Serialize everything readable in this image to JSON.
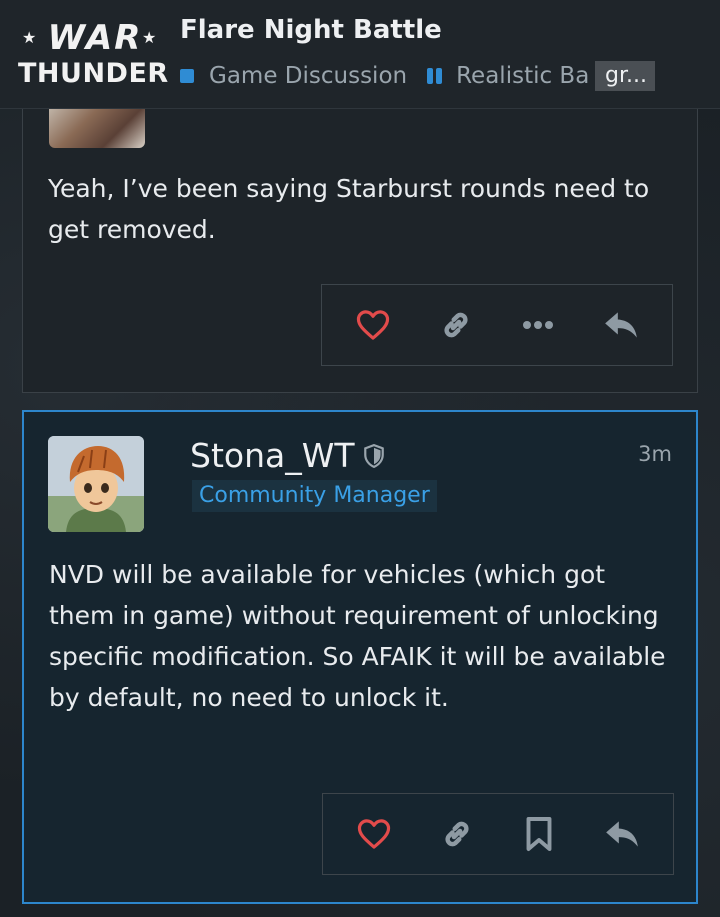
{
  "header": {
    "logo_top": "WAR",
    "logo_bottom": "THUNDER",
    "topic_title": "Flare Night Battle",
    "category": "Game Discussion",
    "subcategory": "Realistic Ba",
    "overflow_label": "gr..."
  },
  "posts": [
    {
      "text": "Yeah, I’ve been saying Starburst rounds need to get removed.",
      "actions": [
        "heart-icon",
        "link-icon",
        "more-icon",
        "reply-icon"
      ]
    },
    {
      "username": "Stona_WT",
      "user_title": "Community Manager",
      "timestamp": "3m",
      "text": "NVD will be available for vehicles (which got them in game) without requirement of unlocking specific modification. So AFAIK it will be available by default, no need to unlock it.",
      "actions": [
        "heart-icon",
        "link-icon",
        "bookmark-icon",
        "reply-icon"
      ]
    }
  ],
  "colors": {
    "accent": "#2f8cd4",
    "highlight_border": "#2d86cc",
    "like": "#e24b4b",
    "icon": "#8e9aa3"
  }
}
